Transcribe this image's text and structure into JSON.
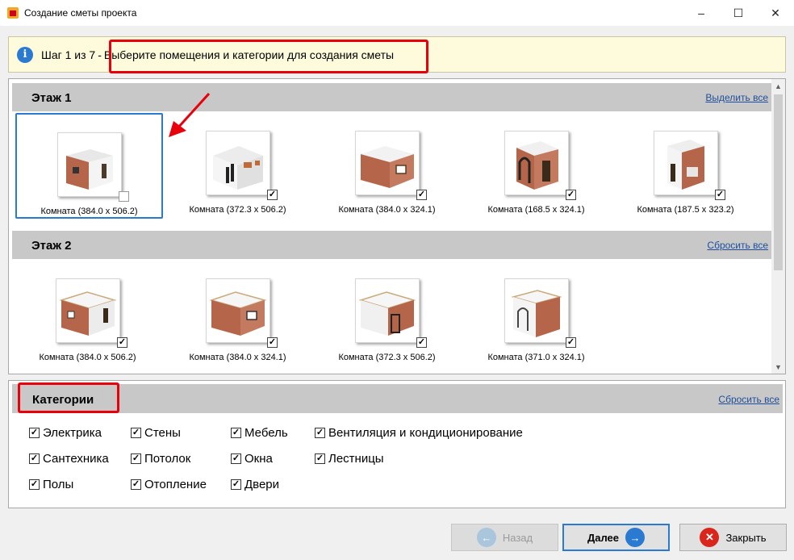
{
  "window": {
    "title": "Создание сметы проекта",
    "controls": [
      "–",
      "☐",
      "✕"
    ]
  },
  "banner": {
    "step": "Шаг 1 из 7",
    "separator": "-",
    "hint": "Выберите помещения и категории для создания сметы"
  },
  "floors": [
    {
      "title": "Этаж 1",
      "action": "Выделить все",
      "rooms": [
        {
          "label": "Комната (384.0 x 506.2)",
          "checked": false,
          "selected": true
        },
        {
          "label": "Комната (372.3 x 506.2)",
          "checked": true,
          "selected": false
        },
        {
          "label": "Комната (384.0 x 324.1)",
          "checked": true,
          "selected": false
        },
        {
          "label": "Комната (168.5 x 324.1)",
          "checked": true,
          "selected": false
        },
        {
          "label": "Комната (187.5 x 323.2)",
          "checked": true,
          "selected": false
        }
      ]
    },
    {
      "title": "Этаж 2",
      "action": "Сбросить все",
      "rooms": [
        {
          "label": "Комната (384.0 x 506.2)",
          "checked": true,
          "selected": false
        },
        {
          "label": "Комната (384.0 x 324.1)",
          "checked": true,
          "selected": false
        },
        {
          "label": "Комната (372.3 x 506.2)",
          "checked": true,
          "selected": false
        },
        {
          "label": "Комната (371.0 x 324.1)",
          "checked": true,
          "selected": false
        }
      ]
    }
  ],
  "categories": {
    "title": "Категории",
    "reset": "Сбросить все",
    "items": [
      {
        "label": "Электрика",
        "checked": true
      },
      {
        "label": "Сантехника",
        "checked": true
      },
      {
        "label": "Полы",
        "checked": true
      },
      {
        "label": "Стены",
        "checked": true
      },
      {
        "label": "Потолок",
        "checked": true
      },
      {
        "label": "Отопление",
        "checked": true
      },
      {
        "label": "Мебель",
        "checked": true
      },
      {
        "label": "Окна",
        "checked": true
      },
      {
        "label": "Двери",
        "checked": true
      },
      {
        "label": "Вентиляция и кондиционирование",
        "checked": true
      },
      {
        "label": "Лестницы",
        "checked": true
      }
    ]
  },
  "buttons": {
    "back": "Назад",
    "next": "Далее",
    "close": "Закрыть"
  },
  "colors": {
    "accent": "#2b7ad1",
    "highlight": "#e8000b",
    "brick": "#b5654a",
    "banner_bg": "#fdfbdc"
  }
}
